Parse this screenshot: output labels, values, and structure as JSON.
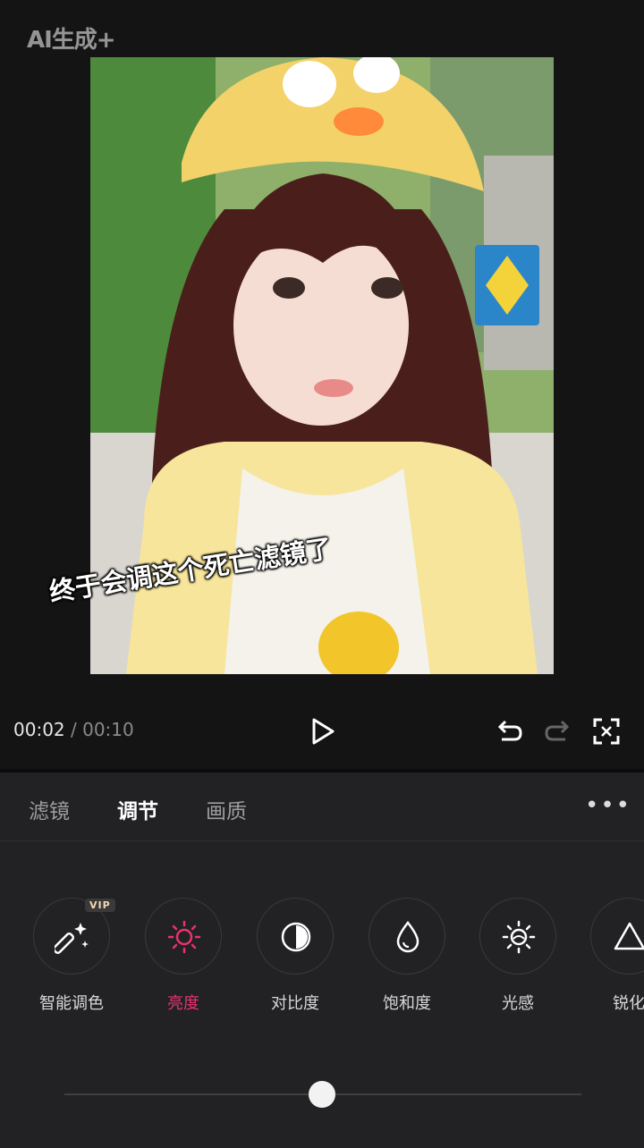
{
  "watermark": "AI生成+",
  "caption": "终于会调这个死亡滤镜了",
  "playback": {
    "current_time": "00:02",
    "separator": "/",
    "total_time": "00:10"
  },
  "tabs": [
    "滤镜",
    "调节",
    "画质"
  ],
  "active_tab": 1,
  "tools": [
    {
      "label": "智能调色",
      "icon": "magic-wand-icon",
      "vip": true
    },
    {
      "label": "亮度",
      "icon": "sun-icon",
      "active": true
    },
    {
      "label": "对比度",
      "icon": "contrast-icon"
    },
    {
      "label": "饱和度",
      "icon": "droplet-icon"
    },
    {
      "label": "光感",
      "icon": "light-sense-icon"
    },
    {
      "label": "锐化",
      "icon": "triangle-icon"
    }
  ],
  "vip_badge": "VIP",
  "slider": {
    "value": 0.5
  },
  "colors": {
    "accent": "#e8336e",
    "background": "#141414",
    "panel": "#222124"
  }
}
